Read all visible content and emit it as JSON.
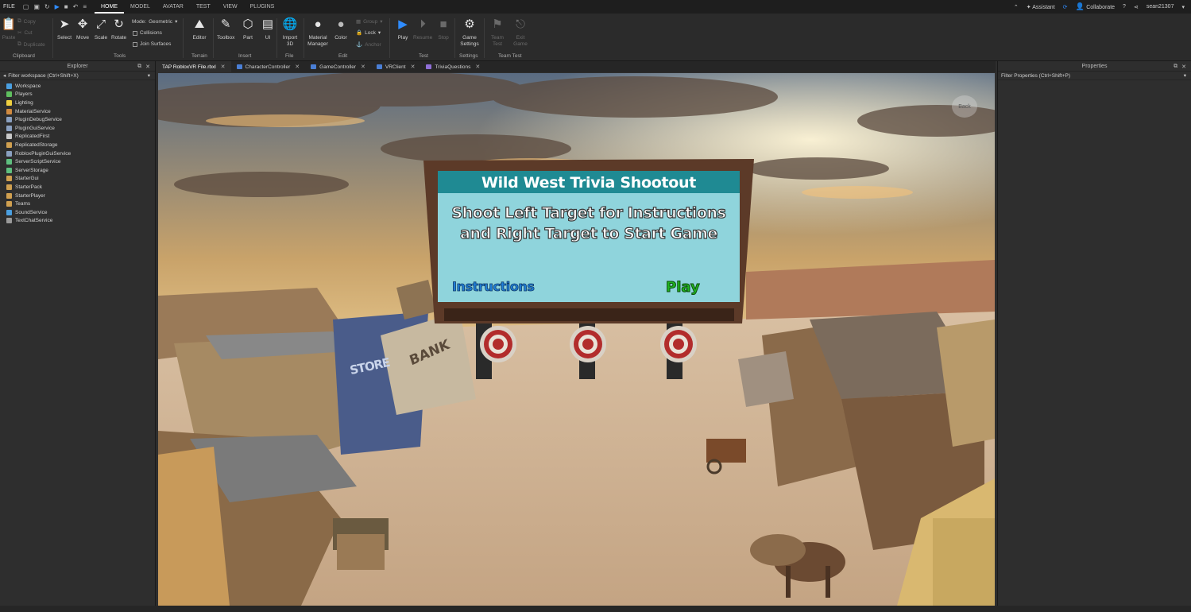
{
  "menubar": {
    "file": "FILE",
    "tabs": [
      "HOME",
      "MODEL",
      "AVATAR",
      "TEST",
      "VIEW",
      "PLUGINS"
    ],
    "active_tab": "HOME",
    "assistant": "Assistant",
    "collaborate": "Collaborate",
    "username": "sean21307"
  },
  "ribbon": {
    "clipboard": {
      "copy": "Copy",
      "cut": "Cut",
      "paste": "Paste",
      "duplicate": "Duplicate",
      "group_label": "Clipboard"
    },
    "tools": {
      "select": "Select",
      "move": "Move",
      "scale": "Scale",
      "rotate": "Rotate",
      "group_label": "Tools"
    },
    "mode": {
      "label": "Mode:",
      "value": "Geometric",
      "collisions": "Collisions",
      "join_surfaces": "Join Surfaces"
    },
    "terrain": {
      "editor": "Editor",
      "group_label": "Terrain"
    },
    "insert": {
      "toolbox": "Toolbox",
      "part": "Part",
      "ui": "UI",
      "group_label": "Insert"
    },
    "file": {
      "import3d": "Import 3D",
      "group_label": "File"
    },
    "edit": {
      "material_manager": "Material Manager",
      "color": "Color",
      "group": "Group",
      "lock": "Lock",
      "anchor": "Anchor",
      "group_label": "Edit"
    },
    "test": {
      "play": "Play",
      "resume": "Resume",
      "stop": "Stop",
      "group_label": "Test"
    },
    "settings": {
      "game_settings": "Game Settings",
      "group_label": "Settings"
    },
    "team_test": {
      "team_test": "Team Test",
      "exit_game": "Exit Game",
      "group_label": "Team Test"
    }
  },
  "explorer": {
    "title": "Explorer",
    "filter": "Filter workspace (Ctrl+Shift+X)",
    "items": [
      {
        "label": "Workspace",
        "color": "#4a9fe0"
      },
      {
        "label": "Players",
        "color": "#5fbf5f"
      },
      {
        "label": "Lighting",
        "color": "#f0d040"
      },
      {
        "label": "MaterialService",
        "color": "#d08a40"
      },
      {
        "label": "PluginDebugService",
        "color": "#8aa0c0"
      },
      {
        "label": "PluginGuiService",
        "color": "#8aa0c0"
      },
      {
        "label": "ReplicatedFirst",
        "color": "#c8c8c8"
      },
      {
        "label": "ReplicatedStorage",
        "color": "#d0a050"
      },
      {
        "label": "RobloxPluginGuiService",
        "color": "#8aa0c0"
      },
      {
        "label": "ServerScriptService",
        "color": "#5fbf7f"
      },
      {
        "label": "ServerStorage",
        "color": "#5fbf7f"
      },
      {
        "label": "StarterGui",
        "color": "#d0a050"
      },
      {
        "label": "StarterPack",
        "color": "#d0a050"
      },
      {
        "label": "StarterPlayer",
        "color": "#d0a050"
      },
      {
        "label": "Teams",
        "color": "#d0a050"
      },
      {
        "label": "SoundService",
        "color": "#4a9fe0"
      },
      {
        "label": "TextChatService",
        "color": "#9a9a9a"
      }
    ]
  },
  "tabs": [
    {
      "label": "TAP RobloxVR File.rbxl",
      "active": true,
      "icon": ""
    },
    {
      "label": "CharacterController",
      "active": false,
      "icon": "script"
    },
    {
      "label": "GameController",
      "active": false,
      "icon": "script"
    },
    {
      "label": "VRClient",
      "active": false,
      "icon": "script"
    },
    {
      "label": "TriviaQuestions",
      "active": false,
      "icon": "module"
    }
  ],
  "viewport": {
    "back_button": "Back",
    "billboard_title": "Wild West Trivia Shootout",
    "billboard_line1": "Shoot Left Target for Instructions",
    "billboard_line2": "and Right Target to Start Game",
    "instructions_label": "Instructions",
    "play_label": "Play",
    "bank_sign": "BANK",
    "store_sign": "STORE"
  },
  "properties": {
    "title": "Properties",
    "filter": "Filter Properties (Ctrl+Shift+P)"
  },
  "colors": {
    "accent_blue": "#2f8cff",
    "billboard_frame": "#5c3a28",
    "billboard_title_bg": "#1f8a93",
    "billboard_body_bg": "#8fd4dc",
    "instructions_color": "#1f7fd8",
    "play_color": "#1fb51f"
  }
}
